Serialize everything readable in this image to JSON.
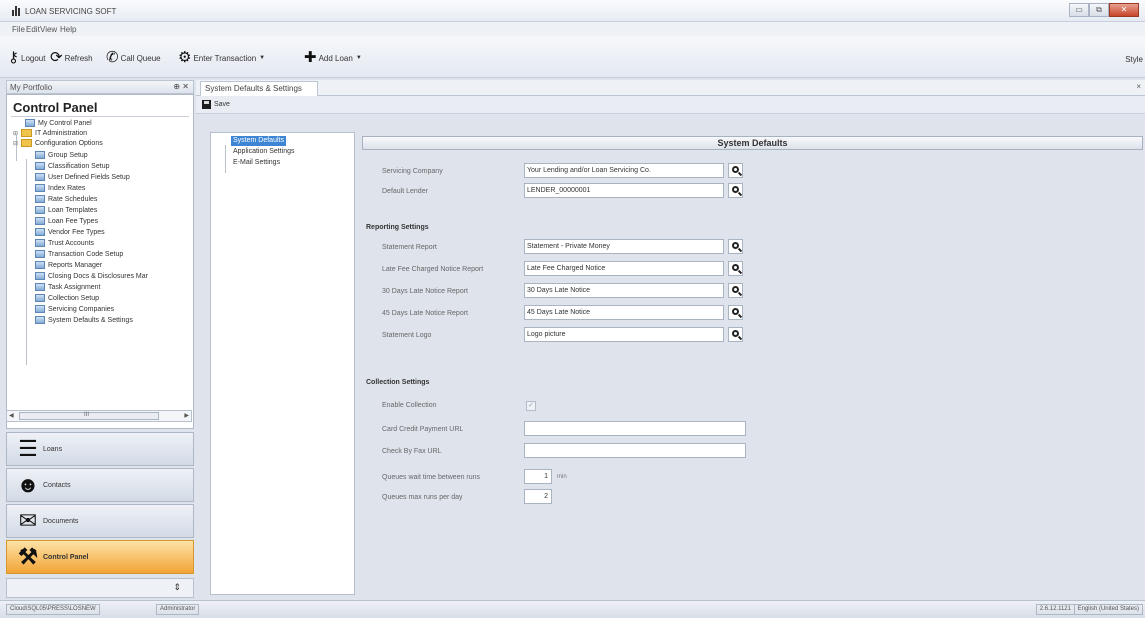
{
  "app": {
    "title": "LOAN SERVICING SOFT",
    "window_controls": [
      "▭",
      "⧉",
      "✕"
    ]
  },
  "menu": [
    "File",
    "Edit",
    "View",
    "Help"
  ],
  "toolbar": {
    "logout": "Logout",
    "refresh": "Refresh",
    "call_queue": "Call Queue",
    "enter_transaction": "Enter Transaction",
    "add_loan": "Add Loan",
    "style": "Style"
  },
  "left_panel": {
    "header": "My Portfolio",
    "pins": "⊕ ✕",
    "title": "Control Panel",
    "tree": [
      "My Control Panel",
      "IT Administration",
      "Configuration Options",
      "Group Setup",
      "Classification Setup",
      "User Defined Fields Setup",
      "Index Rates",
      "Rate Schedules",
      "Loan Templates",
      "Loan Fee Types",
      "Vendor Fee Types",
      "Trust Accounts",
      "Transaction Code Setup",
      "Reports Manager",
      "Closing Docs & Disclosures Mar",
      "Task Assignment",
      "Collection Setup",
      "Servicing Companies",
      "System Defaults & Settings"
    ],
    "scroll_label": "III",
    "nav": [
      "Loans",
      "Contacts",
      "Documents",
      "Control Panel"
    ]
  },
  "document": {
    "tab": "System Defaults & Settings",
    "close": "×",
    "save": "Save",
    "settings_list": [
      "System Defaults",
      "Application Settings",
      "E-Mail Settings"
    ],
    "section_title": "System Defaults",
    "fields": {
      "servicing_company": {
        "label": "Servicing Company",
        "value": "Your Lending and/or Loan Servicing Co."
      },
      "default_lender": {
        "label": "Default Lender",
        "value": "LENDER_00000001"
      }
    },
    "reporting": {
      "title": "Reporting Settings",
      "rows": [
        {
          "label": "Statement Report",
          "value": "Statement - Private Money"
        },
        {
          "label": "Late Fee Charged Notice Report",
          "value": "Late Fee Charged Notice"
        },
        {
          "label": "30 Days Late Notice Report",
          "value": "30 Days Late Notice"
        },
        {
          "label": "45 Days Late Notice Report",
          "value": "45 Days Late Notice"
        },
        {
          "label": "Statement Logo",
          "value": "Logo picture"
        }
      ]
    },
    "collection": {
      "title": "Collection Settings",
      "enable_label": "Enable Collection",
      "enable_mark": "✓",
      "card_label": "Card Credit Payment URL",
      "card_value": "",
      "check_label": "Check By Fax URL",
      "check_value": "",
      "wait_label": "Queues wait time between runs",
      "wait_value": "1",
      "wait_unit": "min",
      "max_label": "Queues max runs per day",
      "max_value": "2"
    }
  },
  "statusbar": {
    "server": "Cloud\\SQL05\\PRESS\\LOSNEW",
    "user": "Administrator",
    "version": "2.6.12.1121",
    "locale": "English (United States)"
  }
}
